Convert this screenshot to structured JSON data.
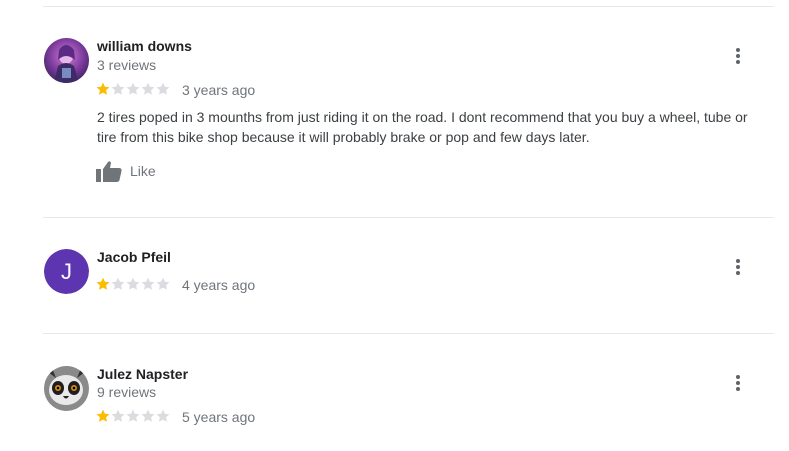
{
  "reviews": [
    {
      "name": "william downs",
      "review_count": "3 reviews",
      "rating": 1,
      "max_rating": 5,
      "date": "3 years ago",
      "text": "2 tires poped in 3 mounths from just riding it on the road. I dont recommend that you buy a wheel, tube or tire from this bike shop because it will probably brake or pop and few days later.",
      "like_label": "Like",
      "avatar_icon": "purple-character-photo"
    },
    {
      "name": "Jacob Pfeil",
      "rating": 1,
      "max_rating": 5,
      "date": "4 years ago",
      "avatar_letter": "J",
      "avatar_color": "#5e35b1"
    },
    {
      "name": "Julez Napster",
      "review_count": "9 reviews",
      "rating": 1,
      "max_rating": 5,
      "date": "5 years ago",
      "avatar_icon": "lemur-photo"
    }
  ],
  "colors": {
    "star_filled": "#fbbc04",
    "star_empty": "#dadce0",
    "secondary_text": "#70757a",
    "menu_icon": "#5f6368"
  },
  "icons": {
    "menu": "more-vert-icon",
    "like": "thumbs-up-icon",
    "star": "star-icon"
  }
}
